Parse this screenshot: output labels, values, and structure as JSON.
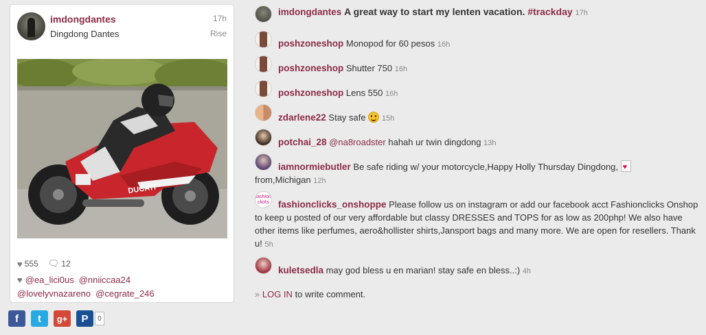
{
  "post": {
    "username": "imdongdantes",
    "display_name": "Dingdong Dantes",
    "time": "17h",
    "location": "Rise",
    "likes_count": "555",
    "comments_count": "12",
    "likers": [
      "@ea_lici0us",
      "@nniiccaa24",
      "@lovelyvnazareno",
      "@cegrate_246"
    ],
    "photo_text": "DUCATI"
  },
  "share": {
    "facebook_label": "f",
    "twitter_label": "t",
    "googleplus_label": "g+",
    "pinterest_label": "P",
    "count": "0"
  },
  "comments": [
    {
      "user": "imdongdantes",
      "text": "A great way to start my lenten vacation.",
      "tag": "#trackday",
      "time": "17h"
    },
    {
      "user": "poshzoneshop",
      "text": "Monopod for 60 pesos",
      "time": "16h"
    },
    {
      "user": "poshzoneshop",
      "text": "Shutter 750",
      "time": "16h"
    },
    {
      "user": "poshzoneshop",
      "text": "Lens 550",
      "time": "16h"
    },
    {
      "user": "zdarlene22",
      "text": "Stay safe",
      "time": "15h"
    },
    {
      "user": "potchai_28",
      "mention": "@na8roadster",
      "text": "hahah ur twin dingdong",
      "time": "13h"
    },
    {
      "user": "iamnormiebutler",
      "text": "Be safe riding w/ your motorcycle,Happy Holly Thursday Dingdong,",
      "text2": "from,Michigan",
      "time": "12h"
    },
    {
      "user": "fashionclicks_onshoppe",
      "text": "Please follow us on instagram or add our facebook acct Fashionclicks Onshop to keep u posted of our very affordable but classy DRESSES and TOPS for as low as 200php! We also have other items like perfumes, aero&hollister shirts,Jansport bags and many more. We are open for resellers. Thank u!",
      "time": "5h",
      "avatar_text": "fashion clicks"
    },
    {
      "user": "kuletsedla",
      "text": "may god bless u en marian! stay safe en bless..:)",
      "time": "4h"
    }
  ],
  "login": {
    "prefix": "»",
    "link": "LOG IN",
    "suffix": "to write comment."
  }
}
